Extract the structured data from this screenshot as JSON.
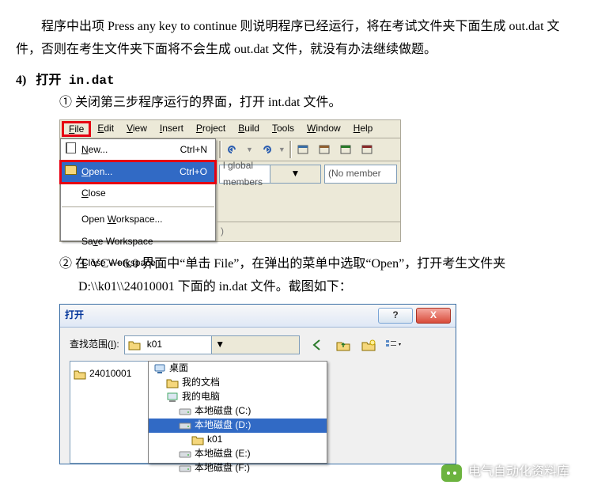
{
  "intro": "程序中出项 Press any key to continue 则说明程序已经运行，将在考试文件夹下面生成 out.dat 文件，否则在考生文件夹下面将不会生成 out.dat 文件，就没有办法继续做题。",
  "step4": {
    "num": "4)",
    "title": "打开 in.dat",
    "item1_marker": "①",
    "item1_text": "关闭第三步程序运行的界面，打开 int.dat 文件。",
    "item2_marker": "②",
    "item2_text": "在 VC++6.0 界面中“单击 File”，在弹出的菜单中选取“Open”，打开考生文件夹 D:\\\\k01\\\\24010001 下面的 in.dat 文件。截图如下："
  },
  "fig1": {
    "menubar": {
      "file_u": "F",
      "file_rest": "ile",
      "edit_u": "E",
      "edit_rest": "dit",
      "view_u": "V",
      "view_rest": "iew",
      "insert_u": "I",
      "insert_rest": "nsert",
      "project_u": "P",
      "project_rest": "roject",
      "build_u": "B",
      "build_rest": "uild",
      "tools_u": "T",
      "tools_rest": "ools",
      "window_u": "W",
      "window_rest": "indow",
      "help_u": "H",
      "help_rest": "elp"
    },
    "menu": {
      "new": {
        "label": "New...",
        "accel": "Ctrl+N"
      },
      "open": {
        "label": "Open...",
        "accel": "Ctrl+O"
      },
      "close": {
        "label": "Close",
        "accel": ""
      },
      "ows_pre": "Open ",
      "ows_u": "W",
      "ows_post": "orkspace...",
      "sws_pre": "Sa",
      "sws_u": "v",
      "sws_post": "e Workspace",
      "cws_pre": "Close Wor",
      "cws_u": "k",
      "cws_post": "space"
    },
    "combos": {
      "left": "l global members",
      "right": "(No member"
    }
  },
  "fig2": {
    "title": "打开",
    "help_btn": "?",
    "close_btn": "X",
    "look_label_pre": "查找范围(",
    "look_label_u": "I",
    "look_label_post": "):",
    "current_dir": "k01",
    "left_folder": "24010001",
    "tree": {
      "desktop": "桌面",
      "mydocs": "我的文档",
      "mypc": "我的电脑",
      "c": "本地磁盘 (C:)",
      "d": "本地磁盘 (D:)",
      "k01": "k01",
      "e": "本地磁盘 (E:)",
      "f": "本地磁盘 (F:)"
    }
  },
  "watermark": "电气自动化资料库"
}
